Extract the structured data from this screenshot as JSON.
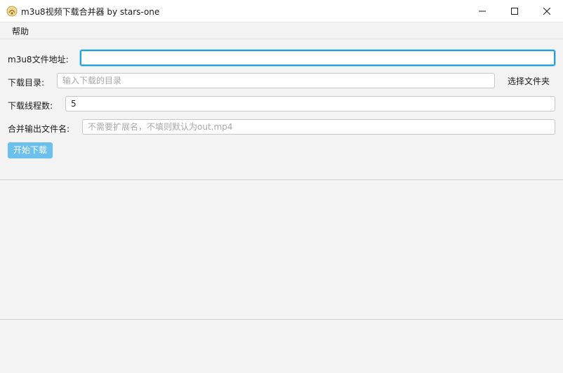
{
  "window": {
    "title": "m3u8视频下载合并器 by stars-one",
    "app_icon": "app-logo-icon",
    "controls": [
      "minimize-icon",
      "maximize-icon",
      "close-icon"
    ]
  },
  "menu": {
    "items": [
      {
        "label": "帮助"
      }
    ]
  },
  "form": {
    "url": {
      "label": "m3u8文件地址:",
      "value": "",
      "placeholder": ""
    },
    "dir": {
      "label": "下载目录:",
      "value": "",
      "placeholder": "输入下载的目录",
      "browse_label": "选择文件夹"
    },
    "threads": {
      "label": "下载线程数:",
      "value": "5"
    },
    "output": {
      "label": "合并输出文件名:",
      "value": "",
      "placeholder": "不需要扩展名，不填则默认为out.mp4"
    },
    "start_label": "开始下载"
  },
  "log": {
    "content": ""
  },
  "colors": {
    "accent": "#27a2d8",
    "start_button": "#6cc0ee",
    "background": "#f3f3f3"
  }
}
